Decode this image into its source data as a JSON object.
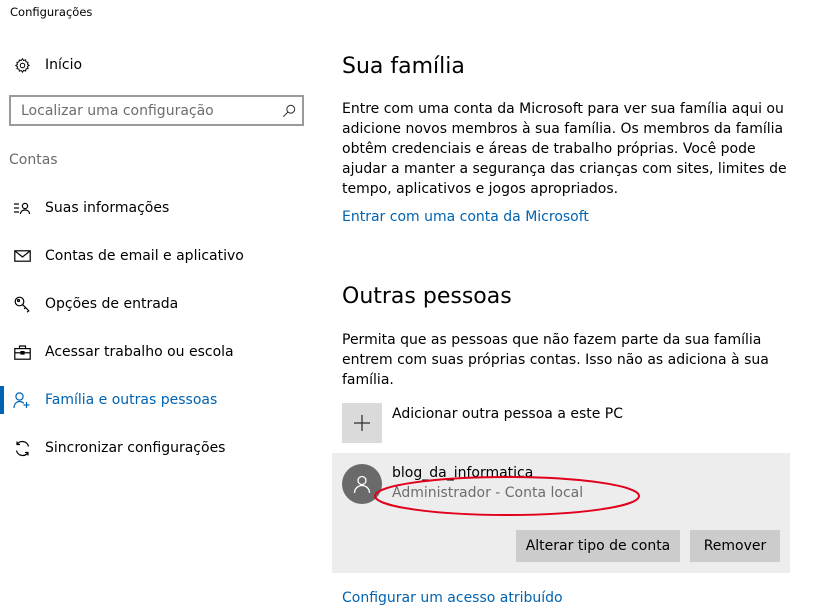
{
  "window": {
    "title": "Configurações"
  },
  "sidebar": {
    "home": {
      "label": "Início",
      "icon": "gear-icon"
    },
    "search": {
      "placeholder": "Localizar uma configuração",
      "value": "",
      "icon": "search-icon"
    },
    "section_label": "Contas",
    "items": [
      {
        "label": "Suas informações",
        "icon": "person-info-icon",
        "active": false
      },
      {
        "label": "Contas de email e aplicativo",
        "icon": "mail-icon",
        "active": false
      },
      {
        "label": "Opções de entrada",
        "icon": "key-icon",
        "active": false
      },
      {
        "label": "Acessar trabalho ou escola",
        "icon": "briefcase-icon",
        "active": false
      },
      {
        "label": "Família e outras pessoas",
        "icon": "person-add-icon",
        "active": true
      },
      {
        "label": "Sincronizar configurações",
        "icon": "sync-icon",
        "active": false
      }
    ]
  },
  "family": {
    "title": "Sua família",
    "description": "Entre com uma conta da Microsoft para ver sua família aqui ou adicione novos membros à sua família. Os membros da família obtêm credenciais e áreas de trabalho próprias. Você pode ajudar a manter a segurança das crianças com sites, limites de tempo, aplicativos e jogos apropriados.",
    "signin_link": "Entrar com uma conta da Microsoft"
  },
  "others": {
    "title": "Outras pessoas",
    "description": "Permita que as pessoas que não fazem parte da sua família entrem com suas próprias contas. Isso não as adiciona à sua família.",
    "add_label": "Adicionar outra pessoa a este PC",
    "user": {
      "name": "blog_da_informatica",
      "role": "Administrador - Conta local",
      "change_button": "Alterar tipo de conta",
      "remove_button": "Remover"
    },
    "assigned_access_link": "Configurar um acesso atribuído"
  },
  "colors": {
    "accent": "#0063b1",
    "highlight": "#e0001b",
    "card_bg": "#ededed",
    "button_bg": "#cccccc"
  }
}
